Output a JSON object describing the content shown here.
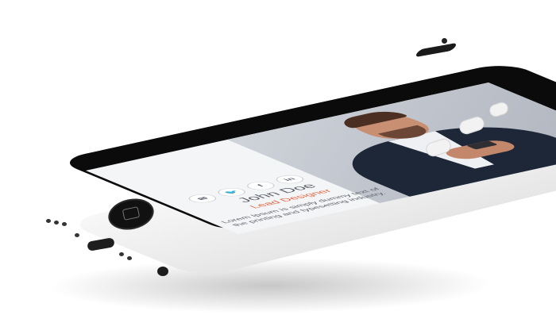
{
  "profile": {
    "name": "John Doe",
    "role": "Lead Designer",
    "bio": "Lorem Ipsum is simply dummy text of the printing and typesetting industry."
  },
  "social": {
    "items": [
      {
        "icon": "envelope-icon",
        "glyph": "✉"
      },
      {
        "icon": "twitter-icon",
        "glyph": "🐦"
      },
      {
        "icon": "facebook-icon",
        "glyph": "f"
      },
      {
        "icon": "linkedin-icon",
        "glyph": "in"
      }
    ]
  },
  "colors": {
    "accent": "#e45d3b",
    "text": "#5a5f68"
  }
}
